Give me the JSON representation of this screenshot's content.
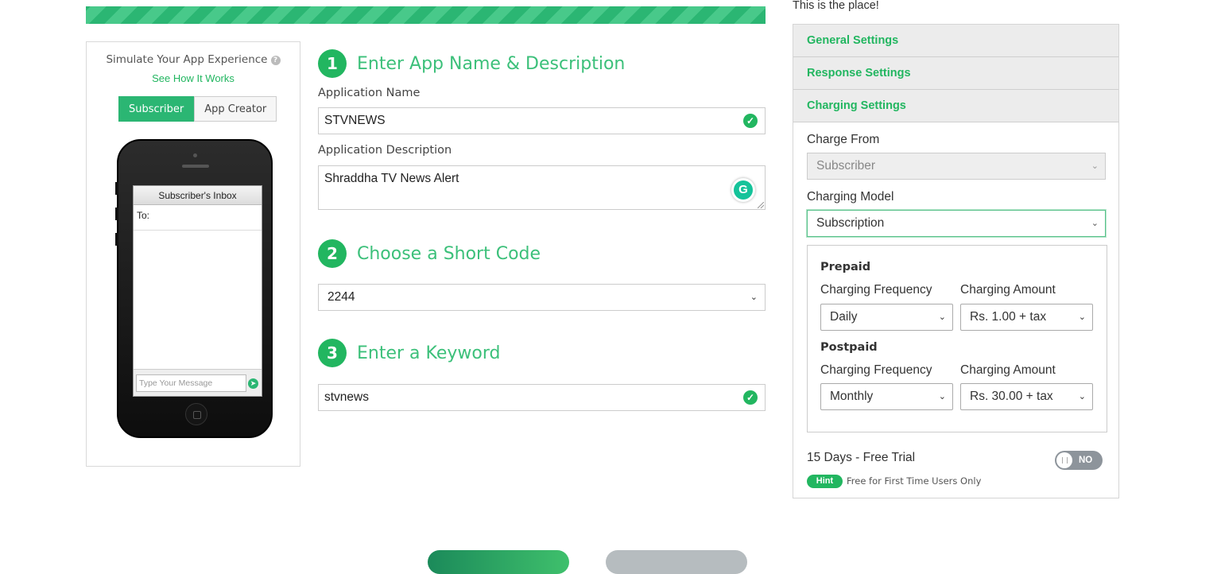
{
  "header": {
    "tagline": "This is the place!"
  },
  "simulator": {
    "title": "Simulate Your App Experience",
    "help_icon": "question-circle-icon",
    "how_link": "See How It Works",
    "tabs": [
      {
        "label": "Subscriber",
        "active": true
      },
      {
        "label": "App Creator",
        "active": false
      }
    ],
    "inbox_title": "Subscriber's Inbox",
    "to_label": "To:",
    "message_placeholder": "Type Your Message",
    "send_icon": "arrow-circle-right-icon"
  },
  "form": {
    "step1": {
      "number": "1",
      "title": "Enter App Name & Description",
      "name_label": "Application Name",
      "name_value": "STVNEWS",
      "desc_label": "Application Description",
      "desc_value": "Shraddha TV News Alert"
    },
    "step2": {
      "number": "2",
      "title": "Choose a Short Code",
      "short_code": "2244"
    },
    "step3": {
      "number": "3",
      "title": "Enter a Keyword",
      "keyword": "stvnews"
    }
  },
  "settings": {
    "sections": [
      "General Settings",
      "Response Settings",
      "Charging Settings"
    ],
    "charge_from_label": "Charge From",
    "charge_from_value": "Subscriber",
    "charging_model_label": "Charging Model",
    "charging_model_value": "Subscription",
    "prepaid": {
      "title": "Prepaid",
      "freq_label": "Charging Frequency",
      "amount_label": "Charging Amount",
      "freq_value": "Daily",
      "amount_value": "Rs. 1.00 + tax"
    },
    "postpaid": {
      "title": "Postpaid",
      "freq_label": "Charging Frequency",
      "amount_label": "Charging Amount",
      "freq_value": "Monthly",
      "amount_value": "Rs. 30.00 + tax"
    },
    "trial_label": "15 Days - Free Trial",
    "trial_toggle": "NO",
    "hint_badge": "Hint",
    "hint_text": "Free for First Time Users Only"
  },
  "colors": {
    "accent": "#22b660",
    "accent_light": "#3cc07a",
    "toggle_off": "#8d949b"
  }
}
